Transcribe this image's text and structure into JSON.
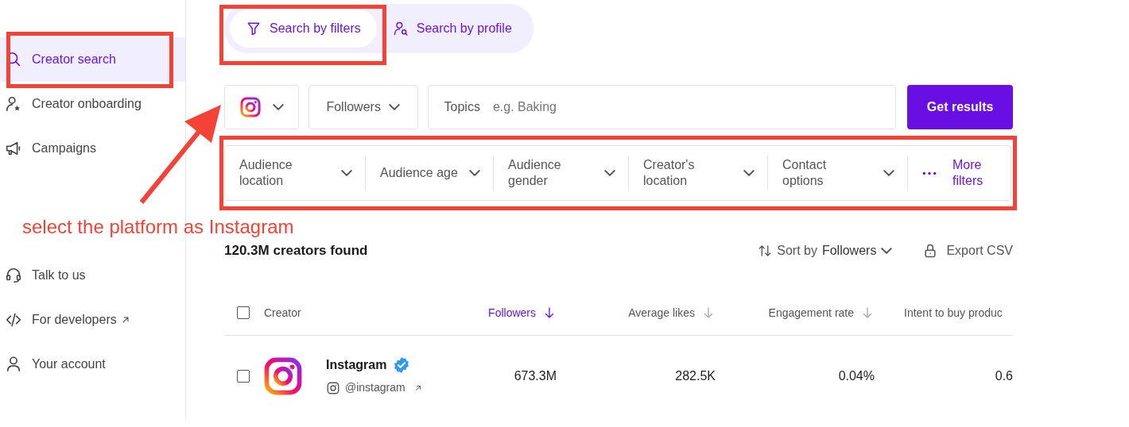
{
  "sidebar": {
    "items": [
      {
        "label": "Creator search",
        "selected": true,
        "external": false
      },
      {
        "label": "Creator onboarding",
        "selected": false,
        "external": false
      },
      {
        "label": "Campaigns",
        "selected": false,
        "external": false
      }
    ],
    "footer_items": [
      {
        "label": "Talk to us",
        "selected": false,
        "external": false
      },
      {
        "label": "For developers",
        "selected": false,
        "external": true
      },
      {
        "label": "Your account",
        "selected": false,
        "external": false
      }
    ]
  },
  "search_tabs": [
    {
      "label": "Search by filters",
      "selected": true
    },
    {
      "label": "Search by profile",
      "selected": false
    }
  ],
  "search_bar": {
    "followers": "Followers",
    "topics_label": "Topics",
    "topics_placeholder": "e.g. Baking",
    "button": "Get results"
  },
  "filters": [
    {
      "label": "Audience location",
      "kind": "dropdown"
    },
    {
      "label": "Audience age",
      "kind": "dropdown"
    },
    {
      "label": "Audience gender",
      "kind": "dropdown"
    },
    {
      "label": "Creator's location",
      "kind": "dropdown"
    },
    {
      "label": "Contact options",
      "kind": "dropdown"
    },
    {
      "label": "More filters",
      "kind": "more"
    }
  ],
  "results": {
    "count": "120.3M creators found",
    "sort_label": "Sort by",
    "sort_value": "Followers",
    "export": "Export CSV"
  },
  "table": {
    "all_checked": false,
    "columns": [
      {
        "label": "Creator",
        "sortable": false,
        "selected": false
      },
      {
        "label": "Followers",
        "sortable": true,
        "selected": true
      },
      {
        "label": "Average likes",
        "sortable": true,
        "selected": false
      },
      {
        "label": "Engagement rate",
        "sortable": true,
        "selected": false
      },
      {
        "label": "Intent to buy produc",
        "sortable": false,
        "selected": false
      }
    ],
    "rows": [
      {
        "checked": false,
        "name": "Instagram",
        "verified": true,
        "handle": "@instagram",
        "cells": [
          "673.3M",
          "282.5K",
          "0.04%",
          "0.6"
        ]
      }
    ]
  },
  "annotation": {
    "text": "select the platform as Instagram"
  }
}
